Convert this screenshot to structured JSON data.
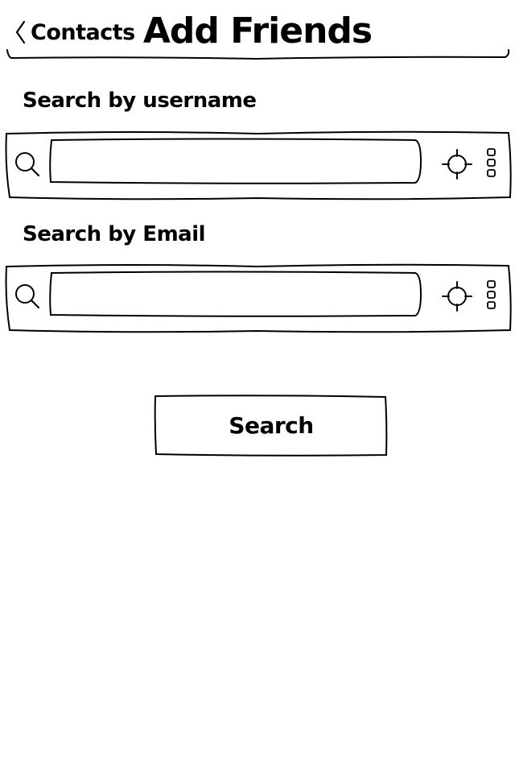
{
  "header": {
    "back_label": "Contacts",
    "title": "Add Friends"
  },
  "username_search": {
    "label": "Search by username",
    "value": "",
    "placeholder": ""
  },
  "email_search": {
    "label": "Search by Email",
    "value": "",
    "placeholder": ""
  },
  "search_button": {
    "label": "Search"
  },
  "icons": {
    "back": "chevron-left-icon",
    "search": "magnifier-icon",
    "locate": "crosshair-icon",
    "list": "list-icon"
  },
  "colors": {
    "ink": "#000000",
    "background": "#ffffff"
  }
}
